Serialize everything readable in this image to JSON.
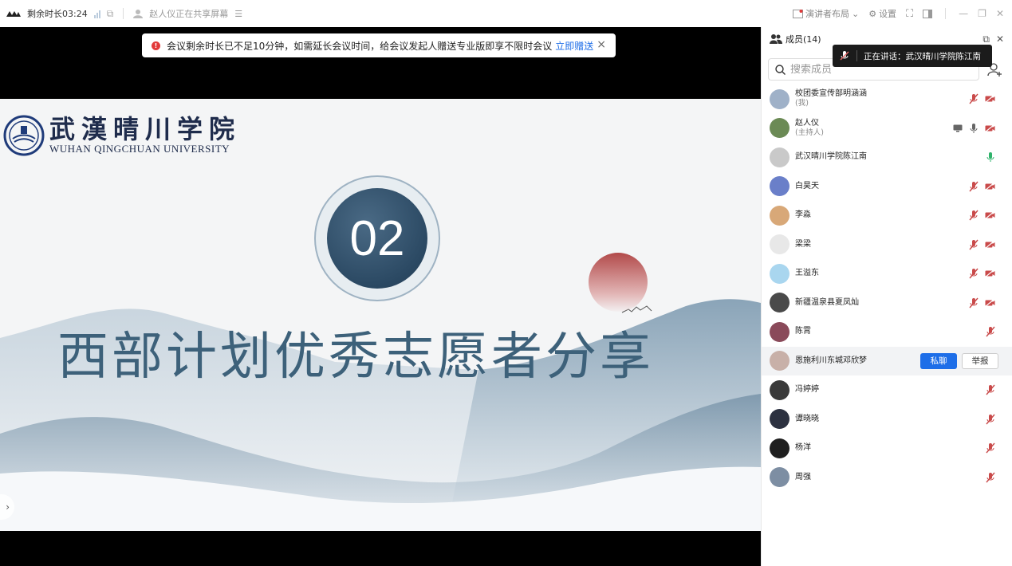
{
  "topbar": {
    "time_left": "剩余时长03:24",
    "sharing_text": "赵人仪正在共享屏幕",
    "layout_label": "演讲者布局",
    "settings_label": "设置"
  },
  "notice": {
    "text": "会议剩余时长已不足10分钟，如需延长会议时间，给会议发起人赠送专业版即享不限时会议",
    "link": "立即赠送",
    "close": "×"
  },
  "slide": {
    "school_cn": "武漢晴川学院",
    "school_en": "WUHAN QINGCHUAN UNIVERSITY",
    "number": "02",
    "title": "西部计划优秀志愿者分享"
  },
  "panel": {
    "title": "成员(14)",
    "search_placeholder": "搜索成员",
    "speaking_tip": "正在讲话：武汉晴川学院陈江南",
    "chat_btn": "私聊",
    "report_btn": "举报",
    "members": [
      {
        "name": "校团委宣传部明涵涵",
        "sub": "(我)",
        "icons": [
          "mic-muted",
          "cam-off"
        ],
        "avatar": "#9fb1c8"
      },
      {
        "name": "赵人仪",
        "sub": "(主持人)",
        "icons": [
          "screen",
          "mic",
          "cam-off"
        ],
        "avatar": "#6b8a55"
      },
      {
        "name": "武汉晴川学院陈江南",
        "sub": "",
        "icons": [
          "mic-active"
        ],
        "avatar": "#c9c9c9"
      },
      {
        "name": "白昊天",
        "sub": "",
        "icons": [
          "mic-muted",
          "cam-off"
        ],
        "avatar": "#6a7fc9"
      },
      {
        "name": "李淼",
        "sub": "",
        "icons": [
          "mic-muted",
          "cam-off"
        ],
        "avatar": "#d8a878"
      },
      {
        "name": "梁梁",
        "sub": "",
        "icons": [
          "mic-muted",
          "cam-off"
        ],
        "avatar": "#e8e8e8"
      },
      {
        "name": "王溢东",
        "sub": "",
        "icons": [
          "mic-muted",
          "cam-off"
        ],
        "avatar": "#a9d6ef"
      },
      {
        "name": "新疆温泉县夏凤灿",
        "sub": "",
        "icons": [
          "mic-muted",
          "cam-off"
        ],
        "avatar": "#4a4a4a"
      },
      {
        "name": "陈霄",
        "sub": "",
        "icons": [
          "mic-muted"
        ],
        "avatar": "#8a4a5a"
      },
      {
        "name": "恩施利川东城邓欣梦",
        "sub": "",
        "icons": [],
        "avatar": "#c8b0a8",
        "hover": true
      },
      {
        "name": "冯婷婷",
        "sub": "",
        "icons": [
          "mic-muted"
        ],
        "avatar": "#3a3a3a"
      },
      {
        "name": "谭晓晓",
        "sub": "",
        "icons": [
          "mic-muted"
        ],
        "avatar": "#2c3140"
      },
      {
        "name": "杨洋",
        "sub": "",
        "icons": [
          "mic-muted"
        ],
        "avatar": "#1f1f1f"
      },
      {
        "name": "周强",
        "sub": "",
        "icons": [
          "mic-muted"
        ],
        "avatar": "#7d8ea3"
      }
    ]
  },
  "colors": {
    "accent": "#1e6ee8",
    "muted_red": "#e06666",
    "active_green": "#2fb36b",
    "title_blue": "#3d617a"
  }
}
